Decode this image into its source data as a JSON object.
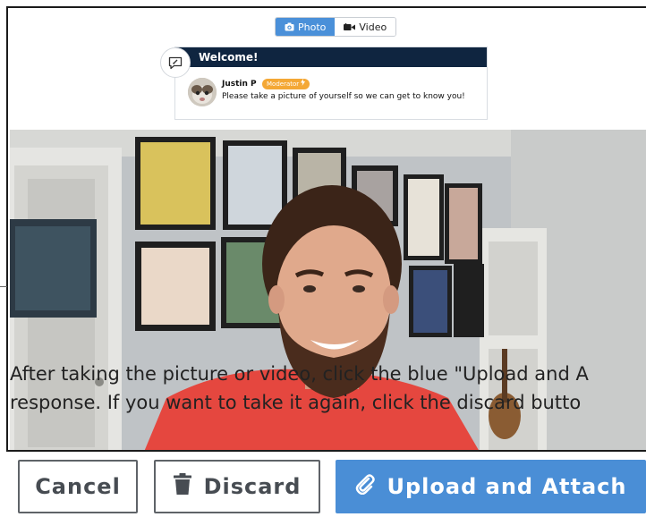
{
  "mode_toggle": {
    "photo_label": "Photo",
    "video_label": "Video",
    "active": "photo"
  },
  "welcome_card": {
    "title": "Welcome!",
    "author_name": "Justin P",
    "role_badge": "Moderator",
    "message": "Please take a picture of yourself so we can get to know you!"
  },
  "instructions": {
    "line1": "After taking the picture or video, click the blue \"Upload and A",
    "line2": "response. If you want to take it again, click the discard butto"
  },
  "actions": {
    "cancel_label": "Cancel",
    "discard_label": "Discard",
    "upload_label": "Upload and Attach"
  },
  "colors": {
    "primary": "#4a8ed6",
    "header_navy": "#0f2540",
    "badge_orange": "#f4a836",
    "outline_gray": "#5f6368"
  },
  "icons": {
    "photo": "camera-icon",
    "video": "video-camera-icon",
    "chat": "chat-edit-icon",
    "discard": "trash-icon",
    "upload": "paperclip-icon"
  }
}
